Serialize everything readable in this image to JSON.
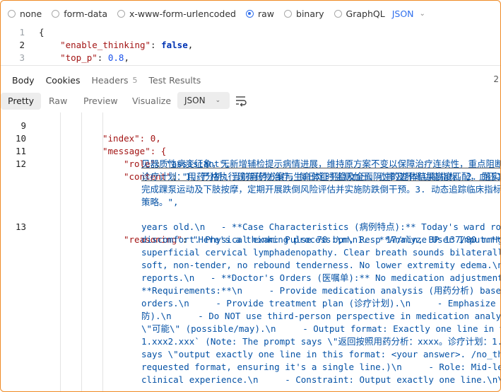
{
  "body_types": {
    "options": [
      "none",
      "form-data",
      "x-www-form-urlencoded",
      "raw",
      "binary",
      "GraphQL"
    ],
    "selected": "raw",
    "format": "JSON"
  },
  "request_editor": {
    "lines": [
      {
        "n": "1",
        "text": "{"
      },
      {
        "n": "2",
        "key": "\"enable_thinking\"",
        "val": "false"
      },
      {
        "n": "3",
        "key": "\"top_p\"",
        "val": "0.8"
      }
    ]
  },
  "response_tabs": [
    {
      "label": "Body",
      "active": true
    },
    {
      "label": "Cookies",
      "active": false
    },
    {
      "label": "Headers",
      "badge": "5",
      "active": false
    },
    {
      "label": "Test Results",
      "active": false
    }
  ],
  "right_edge_glyph": "2",
  "view_tabs": [
    "Pretty",
    "Raw",
    "Preview",
    "Visualize"
  ],
  "active_view": "Pretty",
  "format_select": "JSON",
  "response": {
    "line9": {
      "n": "9",
      "text": "\"index\": 0,"
    },
    "line10": {
      "n": "10",
      "text": "\"message\": {"
    },
    "line11": {
      "n": "11",
      "key": "\"role\"",
      "val": "\"assistant\","
    },
    "line12": {
      "n": "12",
      "key": "\"content\"",
      "val": "\"用药分析：当前用药方案与生命体征平稳及全面阴性的查体结果高度匹配，血压137/8"
    },
    "content_wrap": [
      "见器质性病变征象，无新增辅检提示病情进展，维持原方案不变以保障治疗连续性，重点阻断心",
      "诊疗计划：1. 严格执行现有药物治疗，每日定时监测血压、心率及肝肾功能指标。2. 落实并发",
      "完成踝泵运动及下肢按摩，定期开展跌倒风险评估并实施防跌倒干预。3. 动态追踪临床指标，出",
      "策略。\","
    ],
    "line13": {
      "n": "13",
      "key": "\"reasoning\"",
      "val": "\"Here's a thinking process:\\n\\n1.  **Analyze User Input:**\\n"
    },
    "reasoning_wrap": [
      "years old.\\n   - **Case Characteristics (病例特点):** Today's ward round",
      "discomfort. Physical exam: Pulse 78 bpm, Resp 17/min, BP 137/80 mmHg. C",
      "superficial cervical lymphadenopathy. Clear breath sounds bilaterally.",
      "soft, non-tender, no rebound tenderness. No lower extremity edema.\\n",
      "reports.\\n   - **Doctor's Orders (医嘱单):** No medication adjustments c",
      "**Requirements:**\\n     - Provide medication analysis (用药分析) based o",
      "orders.\\n     - Provide treatment plan (诊疗计划).\\n     - Emphasize com",
      "防).\\n     - Do NOT use third-person perspective in medication analysis",
      "\\\"可能\\\" (possible/may).\\n     - Output format: Exactly one line in the",
      "1.xxx2.xxx` (Note: The prompt says \\\"返回按照用药分析：xxxx。诊疗计划：1.xxx",
      "says \\\"output exactly one line in this format: <your answer>. /no_thin",
      "requested format, ensuring it's a single line.)\\n     - Role: Mid-level",
      "clinical experience.\\n     - Constraint: Output exactly one line.\\n\\n2."
    ]
  }
}
